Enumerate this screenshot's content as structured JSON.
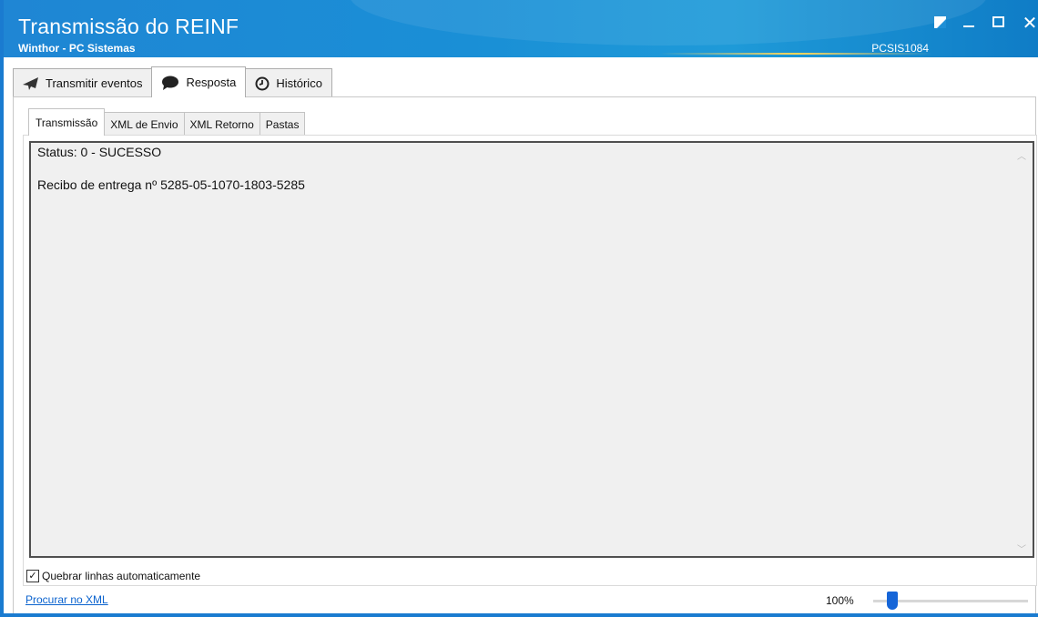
{
  "window": {
    "title": "Transmissão do REINF",
    "subtitle": "Winthor - PC Sistemas",
    "routine_code": "PCSIS1084",
    "colors": {
      "titlebar": "#1e8fd6",
      "accent": "#1565d8",
      "link": "#0b63ce"
    }
  },
  "main_tabs": [
    {
      "label": "Transmitir eventos",
      "icon": "paper-plane-icon",
      "active": false
    },
    {
      "label": "Resposta",
      "icon": "speech-bubble-icon",
      "active": true
    },
    {
      "label": "Histórico",
      "icon": "clock-icon",
      "active": false
    }
  ],
  "sub_tabs": [
    {
      "label": "Transmissão",
      "active": true
    },
    {
      "label": "XML de Envio",
      "active": false
    },
    {
      "label": "XML Retorno",
      "active": false
    },
    {
      "label": "Pastas",
      "active": false
    }
  ],
  "response": {
    "status_line": "Status: 0 - SUCESSO",
    "receipt_line": "Recibo de entrega nº 5285-05-1070-1803-5285"
  },
  "options": {
    "wrap_label": "Quebrar linhas automaticamente",
    "wrap_checked": true,
    "search_link": "Procurar no XML"
  },
  "zoom": {
    "label": "100%",
    "level_fraction": 0.1
  }
}
